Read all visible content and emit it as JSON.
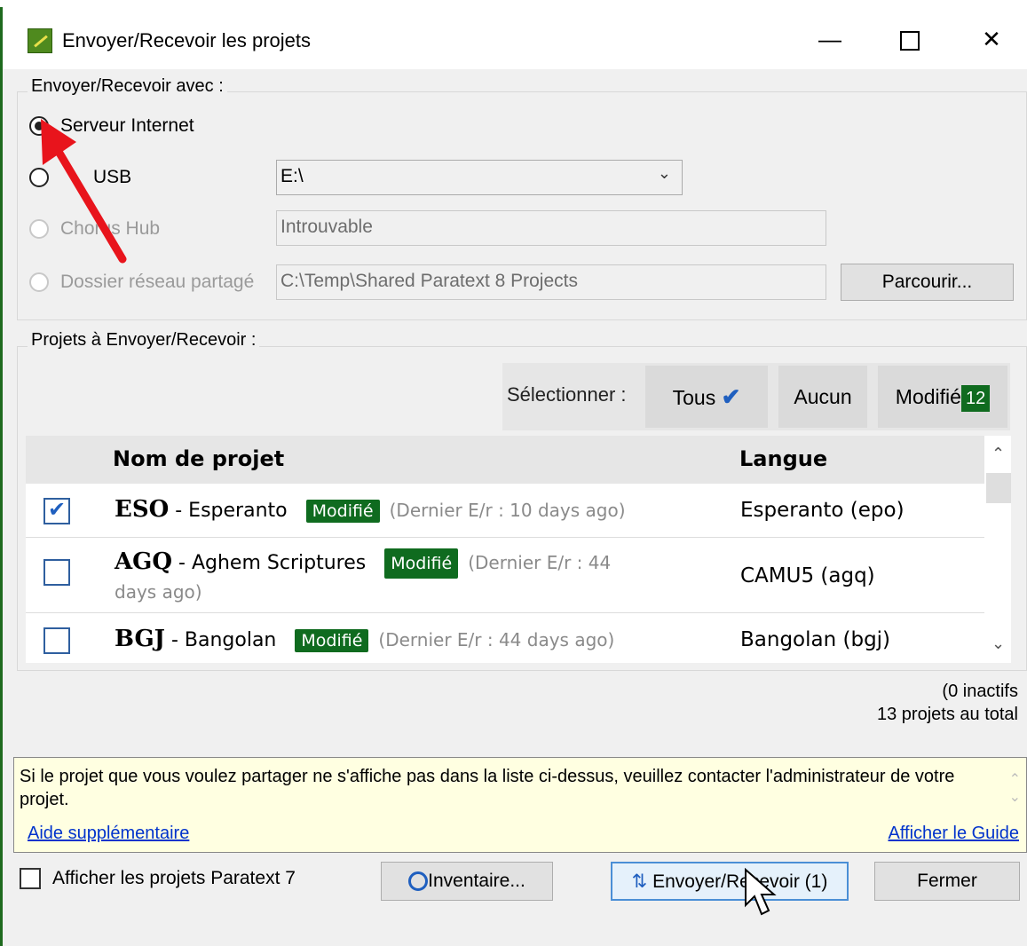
{
  "window": {
    "title": "Envoyer/Recevoir les projets",
    "minimize": "—",
    "close": "✕"
  },
  "connection": {
    "group_title": "Envoyer/Recevoir avec :",
    "options": [
      {
        "label": "Serveur Internet",
        "checked": true,
        "enabled": true
      },
      {
        "label": "USB",
        "checked": false,
        "enabled": true
      },
      {
        "label": "Chorus Hub",
        "checked": false,
        "enabled": false
      },
      {
        "label": "Dossier réseau partagé",
        "checked": false,
        "enabled": false
      }
    ],
    "usb_drive": "E:\\",
    "chorus_value": "Introuvable",
    "shared_path": "C:\\Temp\\Shared Paratext 8 Projects",
    "browse_label": "Parcourir..."
  },
  "projects": {
    "group_title": "Projets à Envoyer/Recevoir :",
    "select_label": "Sélectionner :",
    "all_label": "Tous",
    "none_label": "Aucun",
    "modified_label": "Modifié",
    "modified_count": "12",
    "columns": {
      "name": "Nom de projet",
      "language": "Langue"
    },
    "rows": [
      {
        "checked": true,
        "code": "ESO",
        "name": "- Esperanto",
        "badge": "Modifié",
        "last": "(Dernier E/r : 10 days ago)",
        "language": "Esperanto (epo)"
      },
      {
        "checked": false,
        "code": "AGQ",
        "name": "- Aghem Scriptures",
        "badge": "Modifié",
        "last": "(Dernier E/r : 44",
        "last2": "days ago)",
        "language": "CAMU5 (agq)"
      },
      {
        "checked": false,
        "code": "BGJ",
        "name": "- Bangolan",
        "badge": "Modifié",
        "last": "(Dernier E/r : 44 days ago)",
        "language": "Bangolan (bgj)"
      }
    ],
    "inactive": "(0 inactifs",
    "total": "13 projets au total"
  },
  "info": {
    "text": "Si le projet que vous voulez partager ne s'affiche pas dans la liste ci-dessus, veuillez contacter l'administrateur de votre projet.",
    "help_link": "Aide supplémentaire",
    "guide_link": "Afficher le Guide"
  },
  "footer": {
    "show_pt7_label": "Afficher les projets Paratext 7",
    "inventory_label": "Inventaire...",
    "send_receive_label": "Envoyer/Recevoir (1)",
    "close_label": "Fermer"
  },
  "colors": {
    "accent_green": "#0f6b1f",
    "annotation_arrow": "#e8141c",
    "link": "#0033cc"
  }
}
